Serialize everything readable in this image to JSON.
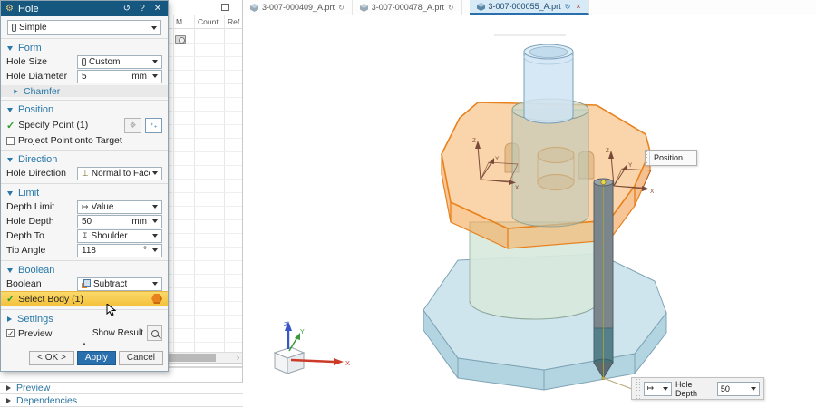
{
  "colors": {
    "titlebar": "#15577e",
    "accent_blue": "#2878a8",
    "apply_button": "#2a6fad",
    "highlight_row": "#f7c94e",
    "selected_body_orange": "#f5a04a",
    "selected_edge_orange": "#e8821e",
    "part_blue": "#cfe4f3",
    "base_blue": "#c3e0ea",
    "hole_preview_gray": "#7b868c"
  },
  "icons": {
    "gear": "⚙",
    "reset": "↺",
    "help": "?",
    "close": "✕",
    "check": "✓",
    "modified": "↻",
    "tab_close": "×",
    "value_limit": "↦",
    "normal_to_face": "⊥",
    "depth_to": "↧",
    "point_plus": "⁺₊",
    "sketch_point": "❖",
    "collapse": "▲",
    "scroll_right": "›"
  },
  "tabs": [
    {
      "label": "3-007-000409_A.prt"
    },
    {
      "label": "3-007-000478_A.prt"
    },
    {
      "label": "3-007-000055_A.prt"
    }
  ],
  "dialog": {
    "title": "Hole",
    "type_value": "Simple",
    "form": {
      "header": "Form",
      "hole_size_label": "Hole Size",
      "hole_size_value": "Custom",
      "hole_diameter_label": "Hole Diameter",
      "hole_diameter_value": "5",
      "hole_diameter_unit": "mm",
      "chamfer_label": "Chamfer"
    },
    "position": {
      "header": "Position",
      "specify_point_label": "Specify Point (1)",
      "project_point_label": "Project Point onto Target"
    },
    "direction": {
      "header": "Direction",
      "hole_direction_label": "Hole Direction",
      "hole_direction_value": "Normal to Face"
    },
    "limit": {
      "header": "Limit",
      "depth_limit_label": "Depth Limit",
      "depth_limit_value": "Value",
      "hole_depth_label": "Hole Depth",
      "hole_depth_value": "50",
      "hole_depth_unit": "mm",
      "depth_to_label": "Depth To",
      "depth_to_value": "Shoulder",
      "tip_angle_label": "Tip Angle",
      "tip_angle_value": "118",
      "tip_angle_unit": "°"
    },
    "boolean": {
      "header": "Boolean",
      "boolean_label": "Boolean",
      "boolean_value": "Subtract",
      "select_body_label": "Select Body (1)"
    },
    "settings": {
      "header": "Settings",
      "preview_label": "Preview",
      "show_result_label": "Show Result"
    },
    "buttons": {
      "ok": "< OK >",
      "apply": "Apply",
      "cancel": "Cancel"
    }
  },
  "navigator": {
    "columns": [
      "M..",
      "Count",
      "Ref"
    ],
    "bottom_sections": [
      {
        "label": "Preview"
      },
      {
        "label": "Dependencies"
      }
    ]
  },
  "viewport": {
    "position_label": "Position",
    "mini_toolbar": {
      "label": "Hole Depth",
      "value": "50"
    },
    "axis": {
      "x": "X",
      "y": "Y",
      "z": "Z"
    }
  }
}
